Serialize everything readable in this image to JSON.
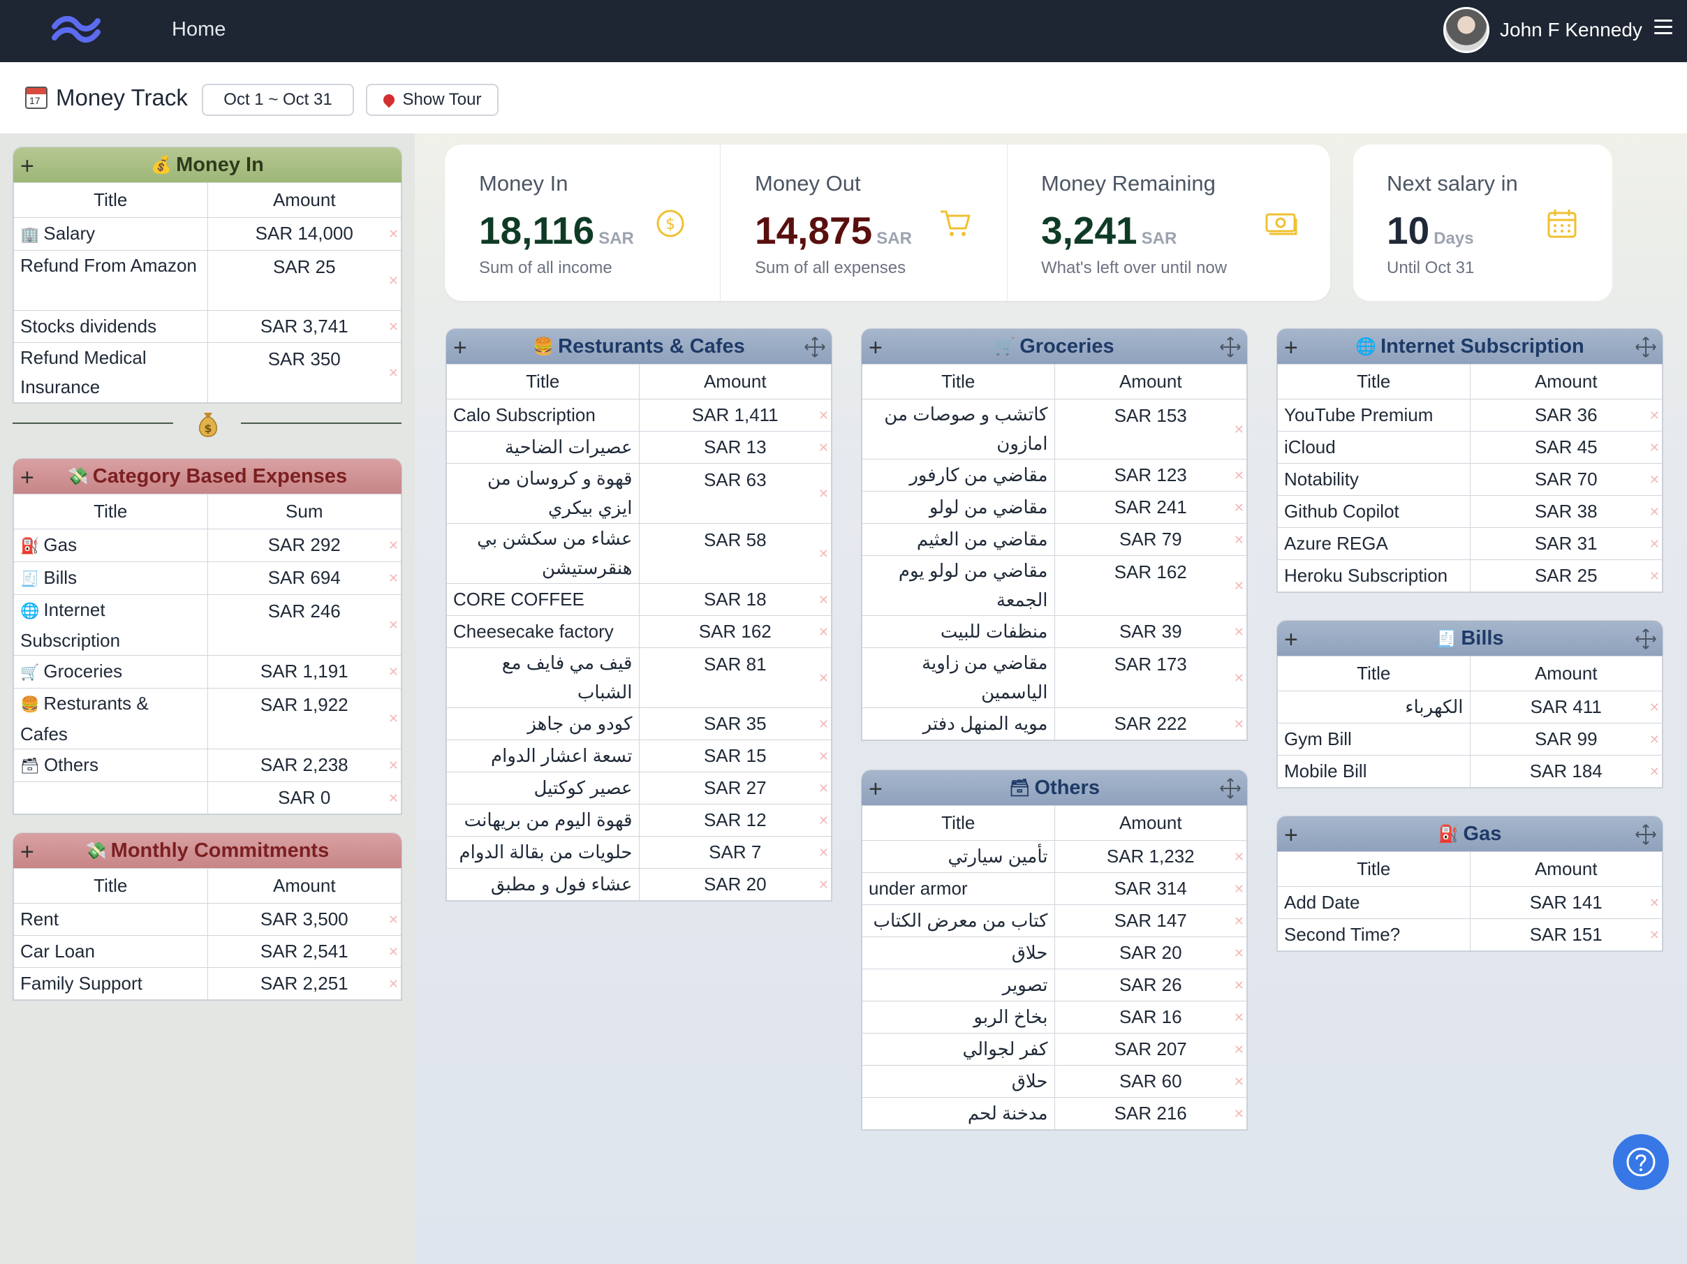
{
  "nav": {
    "home": "Home",
    "user": "John F Kennedy"
  },
  "header": {
    "title": "Money Track",
    "date_range": "Oct 1 ~ Oct 31",
    "tour": "Show Tour"
  },
  "stats": [
    {
      "label": "Money In",
      "value": "18,116",
      "unit": "SAR",
      "sub": "Sum of all income",
      "color": "#0f3b26",
      "icon": "dollar-coin-icon"
    },
    {
      "label": "Money Out",
      "value": "14,875",
      "unit": "SAR",
      "sub": "Sum of all expenses",
      "color": "#5a0f0f",
      "icon": "cart-icon"
    },
    {
      "label": "Money Remaining",
      "value": "3,241",
      "unit": "SAR",
      "sub": "What's left over until now",
      "color": "#0f3b26",
      "icon": "cash-icon"
    },
    {
      "label": "Next salary in",
      "value": "10",
      "unit": "Days",
      "sub": "Until Oct 31",
      "color": "#1f2937",
      "icon": "calendar-icon"
    }
  ],
  "colors": {
    "navbar": "#1e2533",
    "accent_icon": "#f0c030",
    "help_button": "#3778e6"
  },
  "money_in": {
    "title": "Money In",
    "col_title": "Title",
    "col_amount": "Amount",
    "rows": [
      {
        "title": "Salary",
        "amount": "SAR 14,000"
      },
      {
        "title": "Refund From Amazon",
        "amount": "SAR 25"
      },
      {
        "title": "Stocks dividends",
        "amount": "SAR 3,741"
      },
      {
        "title": "Refund Medical Insurance",
        "amount": "SAR 350"
      }
    ]
  },
  "category_expenses": {
    "title": "Category Based Expenses",
    "col_title": "Title",
    "col_sum": "Sum",
    "rows": [
      {
        "title": "Gas",
        "amount": "SAR 292"
      },
      {
        "title": "Bills",
        "amount": "SAR 694"
      },
      {
        "title": "Internet Subscription",
        "amount": "SAR 246"
      },
      {
        "title": "Groceries",
        "amount": "SAR 1,191"
      },
      {
        "title": "Resturants & Cafes",
        "amount": "SAR 1,922"
      },
      {
        "title": "Others",
        "amount": "SAR 2,238"
      },
      {
        "title": "",
        "amount": "SAR 0"
      }
    ]
  },
  "monthly_commitments": {
    "title": "Monthly Commitments",
    "col_title": "Title",
    "col_amount": "Amount",
    "rows": [
      {
        "title": "Rent",
        "amount": "SAR 3,500"
      },
      {
        "title": "Car Loan",
        "amount": "SAR 2,541"
      },
      {
        "title": "Family Support",
        "amount": "SAR 2,251"
      }
    ]
  },
  "restaurants": {
    "title": "Resturants & Cafes",
    "col_title": "Title",
    "col_amount": "Amount",
    "rows": [
      {
        "title": "Calo Subscription",
        "amount": "SAR 1,411"
      },
      {
        "title": "عصيرات الضاحية",
        "amount": "SAR 13"
      },
      {
        "title": "قهوة و كروسان من ايزي بيكري",
        "amount": "SAR 63"
      },
      {
        "title": "عشاء من سكشن بي هنقرستيشن",
        "amount": "SAR 58"
      },
      {
        "title": "CORE COFFEE",
        "amount": "SAR 18"
      },
      {
        "title": "Cheesecake factory",
        "amount": "SAR 162"
      },
      {
        "title": "قيف مي فايف مع الشباب",
        "amount": "SAR 81"
      },
      {
        "title": "كودو من جاهز",
        "amount": "SAR 35"
      },
      {
        "title": "تسعة اعشار الدوام",
        "amount": "SAR 15"
      },
      {
        "title": "عصير كوكتيل",
        "amount": "SAR 27"
      },
      {
        "title": "قهوة اليوم من بريهانت",
        "amount": "SAR 12"
      },
      {
        "title": "حلويات من بقالة الدوام",
        "amount": "SAR 7"
      },
      {
        "title": "عشاء فول و مطبق",
        "amount": "SAR 20"
      }
    ]
  },
  "groceries": {
    "title": "Groceries",
    "col_title": "Title",
    "col_amount": "Amount",
    "rows": [
      {
        "title": "كاتشب و صوصات من امازون",
        "amount": "SAR 153"
      },
      {
        "title": "مقاضي من كارفور",
        "amount": "SAR 123"
      },
      {
        "title": "مقاضي من لولو",
        "amount": "SAR 241"
      },
      {
        "title": "مقاضي من العثيم",
        "amount": "SAR 79"
      },
      {
        "title": "مقاضي من لولو يوم الجمعة",
        "amount": "SAR 162"
      },
      {
        "title": "منظفات للبيت",
        "amount": "SAR 39"
      },
      {
        "title": "مقاضي من زاوية الياسمين",
        "amount": "SAR 173"
      },
      {
        "title": "مويه المنهل دفتر",
        "amount": "SAR 222"
      }
    ]
  },
  "others": {
    "title": "Others",
    "col_title": "Title",
    "col_amount": "Amount",
    "rows": [
      {
        "title": "تأمين سيارتي",
        "amount": "SAR 1,232"
      },
      {
        "title": "under armor",
        "amount": "SAR 314"
      },
      {
        "title": "كتاب من معرض الكتاب",
        "amount": "SAR 147"
      },
      {
        "title": "حلاق",
        "amount": "SAR 20"
      },
      {
        "title": "تصوير",
        "amount": "SAR 26"
      },
      {
        "title": "بخاخ الربو",
        "amount": "SAR 16"
      },
      {
        "title": "كفر لجوالي",
        "amount": "SAR 207"
      },
      {
        "title": "حلاق",
        "amount": "SAR 60"
      },
      {
        "title": "مدخنة لحم",
        "amount": "SAR 216"
      }
    ]
  },
  "internet": {
    "title": "Internet Subscription",
    "col_title": "Title",
    "col_amount": "Amount",
    "rows": [
      {
        "title": "YouTube Premium",
        "amount": "SAR 36"
      },
      {
        "title": "iCloud",
        "amount": "SAR 45"
      },
      {
        "title": "Notability",
        "amount": "SAR 70"
      },
      {
        "title": "Github Copilot",
        "amount": "SAR 38"
      },
      {
        "title": "Azure REGA",
        "amount": "SAR 31"
      },
      {
        "title": "Heroku Subscription",
        "amount": "SAR 25"
      }
    ]
  },
  "bills": {
    "title": "Bills",
    "col_title": "Title",
    "col_amount": "Amount",
    "rows": [
      {
        "title": "الكهرباء",
        "amount": "SAR 411"
      },
      {
        "title": "Gym Bill",
        "amount": "SAR 99"
      },
      {
        "title": "Mobile Bill",
        "amount": "SAR 184"
      }
    ]
  },
  "gas": {
    "title": "Gas",
    "col_title": "Title",
    "col_amount": "Amount",
    "rows": [
      {
        "title": "Add Date",
        "amount": "SAR 141"
      },
      {
        "title": "Second Time?",
        "amount": "SAR 151"
      }
    ]
  }
}
